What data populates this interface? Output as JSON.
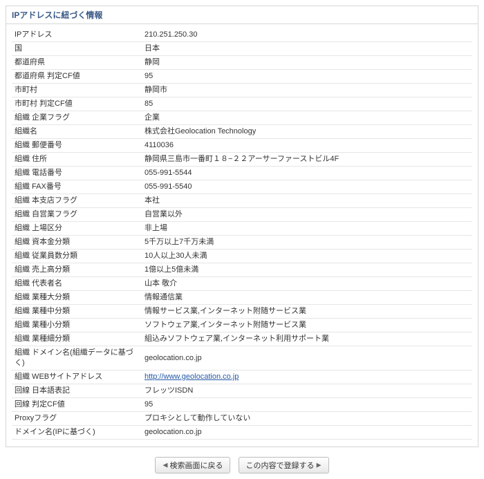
{
  "panel_title": "IPアドレスに紐づく情報",
  "rows": [
    {
      "label": "IPアドレス",
      "value": "210.251.250.30"
    },
    {
      "label": "国",
      "value": "日本"
    },
    {
      "label": "都道府県",
      "value": "静岡"
    },
    {
      "label": "都道府県 判定CF値",
      "value": "95"
    },
    {
      "label": "市町村",
      "value": "静岡市"
    },
    {
      "label": "市町村 判定CF値",
      "value": "85"
    },
    {
      "label": "組織 企業フラグ",
      "value": "企業"
    },
    {
      "label": "組織名",
      "value": "株式会社Geolocation Technology"
    },
    {
      "label": "組織 郵便番号",
      "value": "4110036"
    },
    {
      "label": "組織 住所",
      "value": "静岡県三島市一番町１８−２２アーサーファーストビル4F"
    },
    {
      "label": "組織 電話番号",
      "value": "055-991-5544"
    },
    {
      "label": "組織 FAX番号",
      "value": "055-991-5540"
    },
    {
      "label": "組織 本支店フラグ",
      "value": "本社"
    },
    {
      "label": "組織 自営業フラグ",
      "value": "自営業以外"
    },
    {
      "label": "組織 上場区分",
      "value": "非上場"
    },
    {
      "label": "組織 資本金分類",
      "value": "5千万以上7千万未満"
    },
    {
      "label": "組織 従業員数分類",
      "value": "10人以上30人未満"
    },
    {
      "label": "組織 売上高分類",
      "value": "1億以上5億未満"
    },
    {
      "label": "組織 代表者名",
      "value": "山本 敬介"
    },
    {
      "label": "組織 業種大分類",
      "value": "情報通信業"
    },
    {
      "label": "組織 業種中分類",
      "value": "情報サービス業,インターネット附随サービス業"
    },
    {
      "label": "組織 業種小分類",
      "value": "ソフトウェア業,インターネット附随サービス業"
    },
    {
      "label": "組織 業種細分類",
      "value": "組込みソフトウェア業,インターネット利用サポート業"
    },
    {
      "label": "組織 ドメイン名(組織データに基づく)",
      "value": "geolocation.co.jp"
    },
    {
      "label": "組織 WEBサイトアドレス",
      "value": "http://www.geolocation.co.jp",
      "link": true
    },
    {
      "label": "回線 日本語表記",
      "value": "フレッツISDN"
    },
    {
      "label": "回線 判定CF値",
      "value": "95"
    },
    {
      "label": "Proxyフラグ",
      "value": "プロキシとして動作していない"
    },
    {
      "label": "ドメイン名(IPに基づく)",
      "value": "geolocation.co.jp"
    }
  ],
  "buttons": {
    "back": "検索画面に戻る",
    "register": "この内容で登録する"
  }
}
